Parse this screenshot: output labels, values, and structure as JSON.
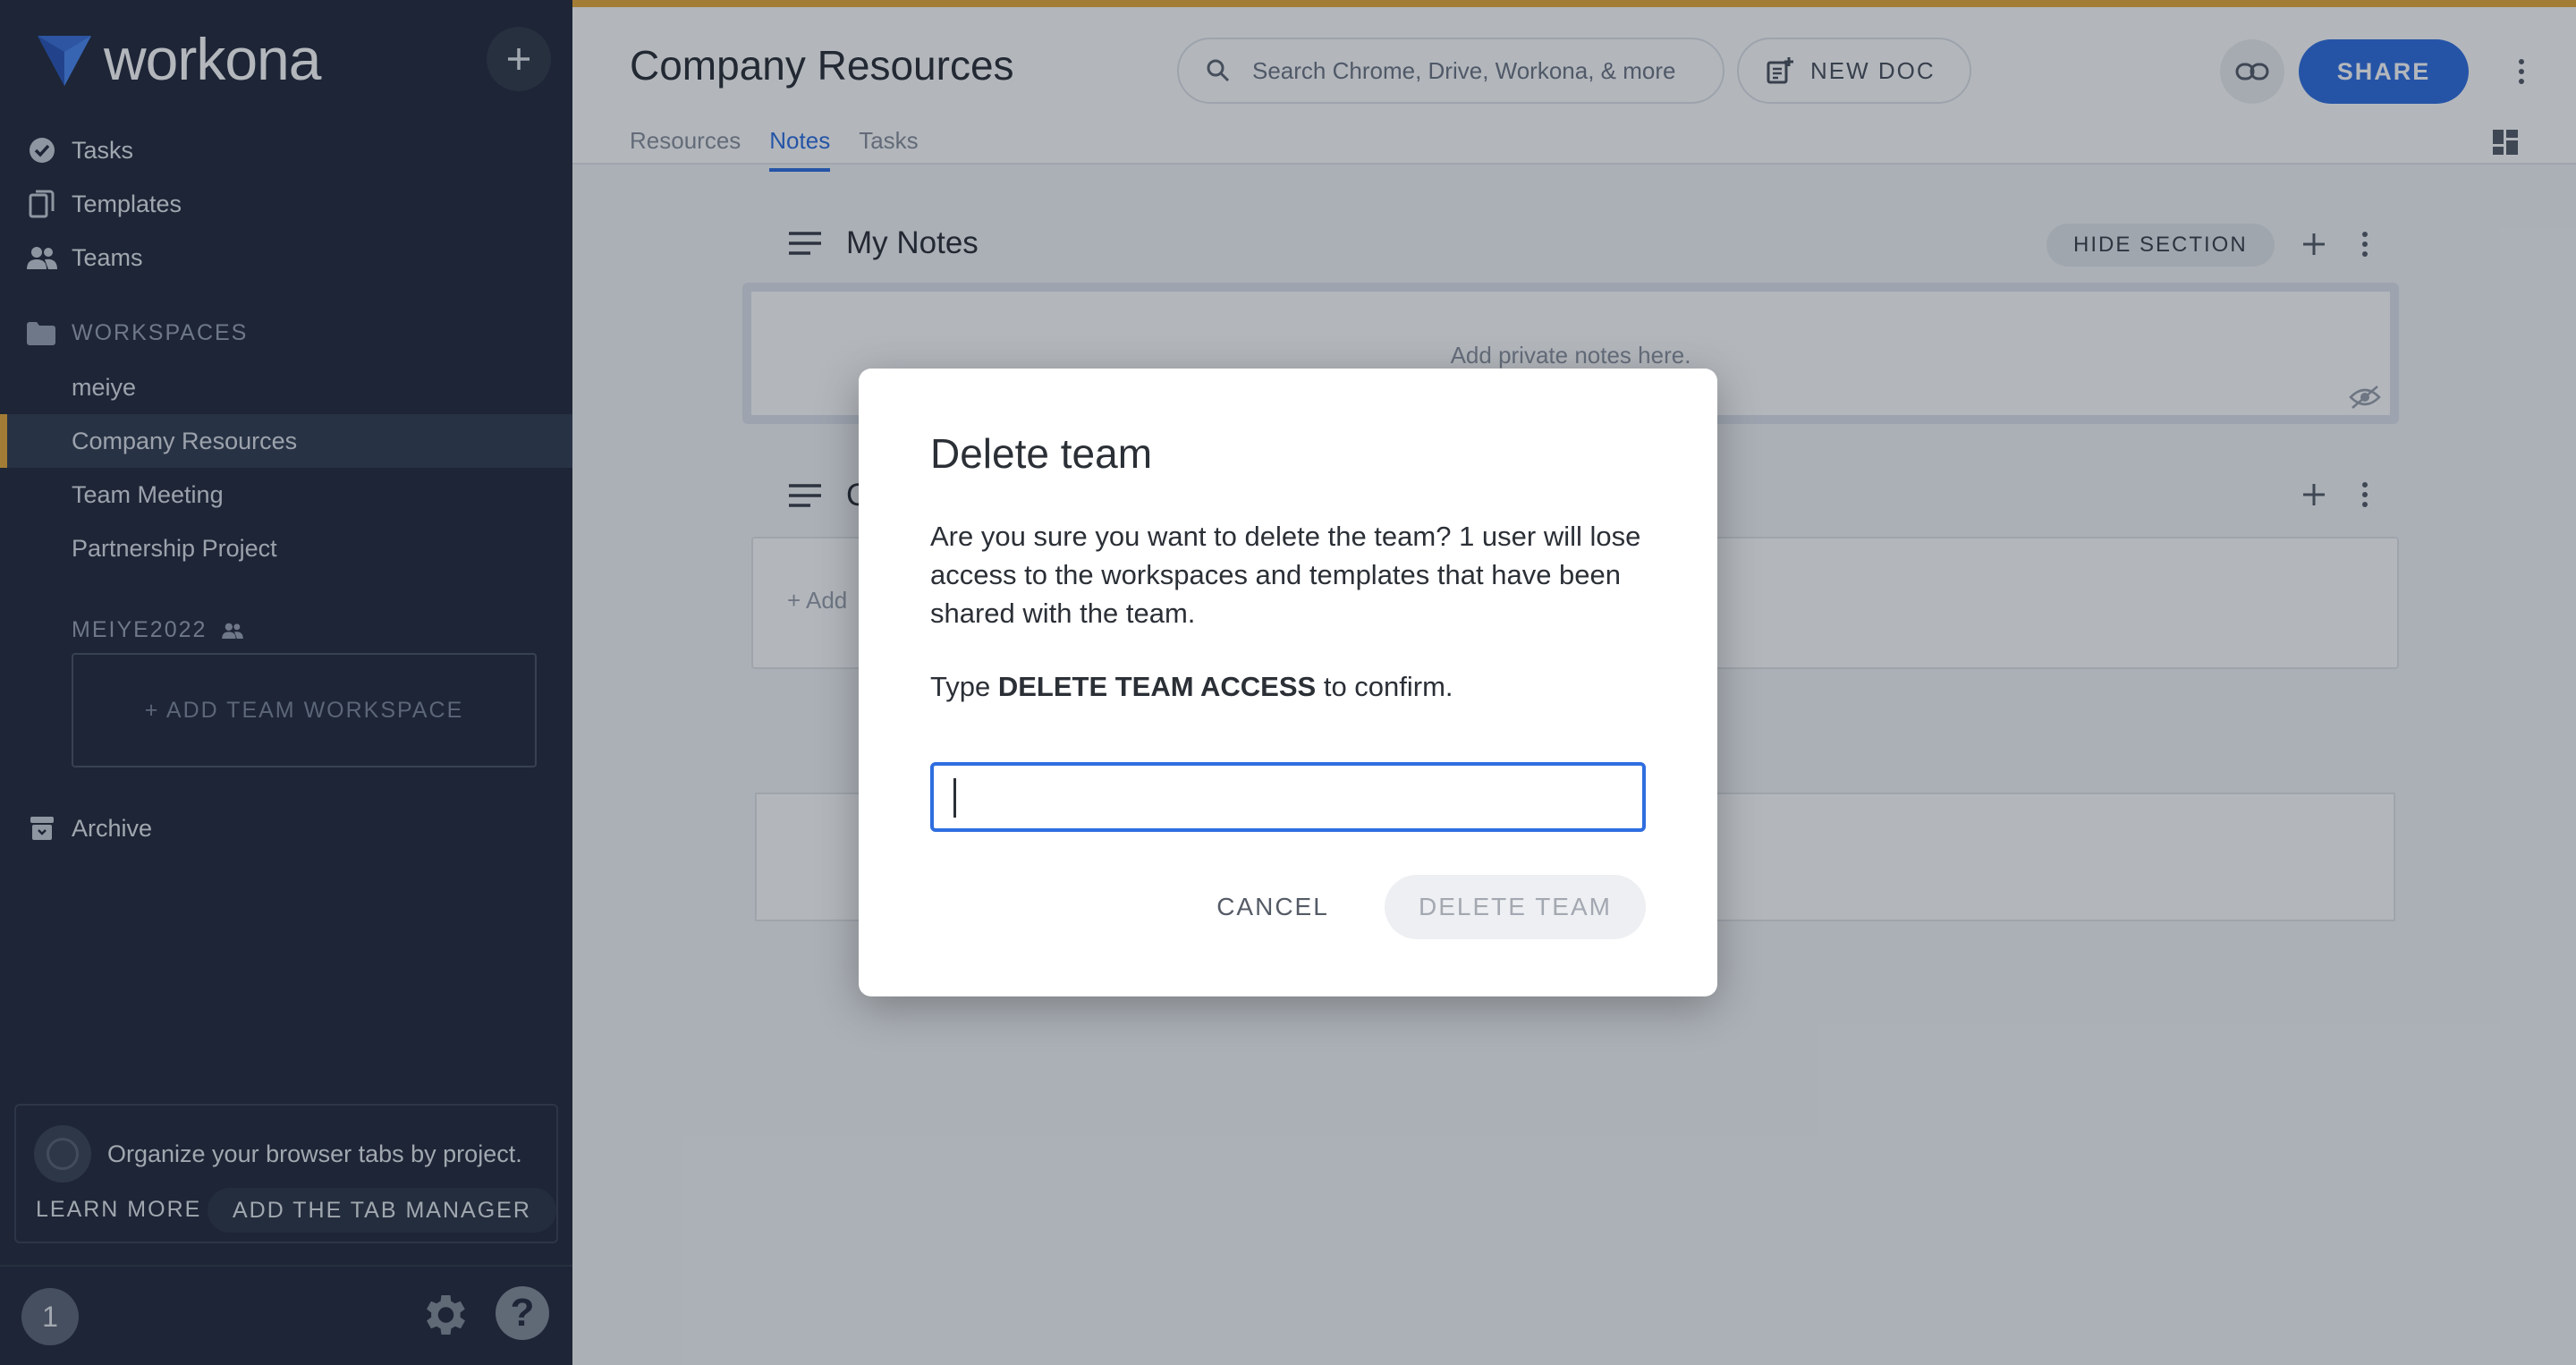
{
  "app": {
    "name": "workona"
  },
  "sidebar": {
    "nav": [
      {
        "label": "Tasks",
        "icon": "check-circle-icon"
      },
      {
        "label": "Templates",
        "icon": "templates-icon"
      },
      {
        "label": "Teams",
        "icon": "people-icon"
      }
    ],
    "workspaces_label": "WORKSPACES",
    "workspaces": [
      {
        "label": "meiye",
        "active": false
      },
      {
        "label": "Company Resources",
        "active": true
      },
      {
        "label": "Team Meeting",
        "active": false
      },
      {
        "label": "Partnership Project",
        "active": false
      }
    ],
    "team_label": "MEIYE2022",
    "add_team_workspace": "+ ADD TEAM WORKSPACE",
    "archive": "Archive",
    "promo": {
      "text": "Organize your browser tabs by project.",
      "learn_more": "LEARN MORE",
      "add_tab_manager": "ADD THE TAB MANAGER"
    },
    "user_initial": "1"
  },
  "header": {
    "title": "Company Resources",
    "search_placeholder": "Search Chrome, Drive, Workona, & more",
    "new_doc": "NEW DOC",
    "share": "SHARE",
    "tabs": [
      {
        "label": "Resources",
        "active": false
      },
      {
        "label": "Notes",
        "active": true
      },
      {
        "label": "Tasks",
        "active": false
      }
    ]
  },
  "content": {
    "my_notes_title": "My Notes",
    "hide_section": "HIDE SECTION",
    "private_notes_placeholder": "Add private notes here.",
    "section2_title": "C",
    "add_text": "+ Add"
  },
  "dialog": {
    "title": "Delete team",
    "body": "Are you sure you want to delete the team? 1 user will lose access to the workspaces and templates that have been shared with the team.",
    "confirm_prefix": "Type ",
    "confirm_phrase": "DELETE TEAM ACCESS",
    "confirm_suffix": " to confirm.",
    "input_value": "",
    "cancel": "CANCEL",
    "delete": "DELETE TEAM"
  },
  "colors": {
    "accent_orange": "#e8a838",
    "primary_blue": "#2f6ee0",
    "sidebar_bg": "#23293a"
  }
}
